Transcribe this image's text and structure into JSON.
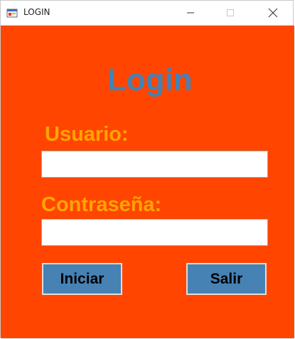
{
  "window": {
    "title": "LOGIN",
    "icon": "windows-form-icon",
    "controls": {
      "minimize": "minimize-icon",
      "maximize": "maximize-icon",
      "close": "close-icon"
    }
  },
  "form": {
    "heading": "Login",
    "username_label": "Usuario:",
    "username_value": "",
    "password_label": "Contraseña:",
    "password_value": "",
    "login_button": "Iniciar",
    "exit_button": "Salir"
  },
  "colors": {
    "background": "#ff4500",
    "heading": "#4682b4",
    "labels": "#ffa500",
    "buttons": "#4682b4"
  }
}
